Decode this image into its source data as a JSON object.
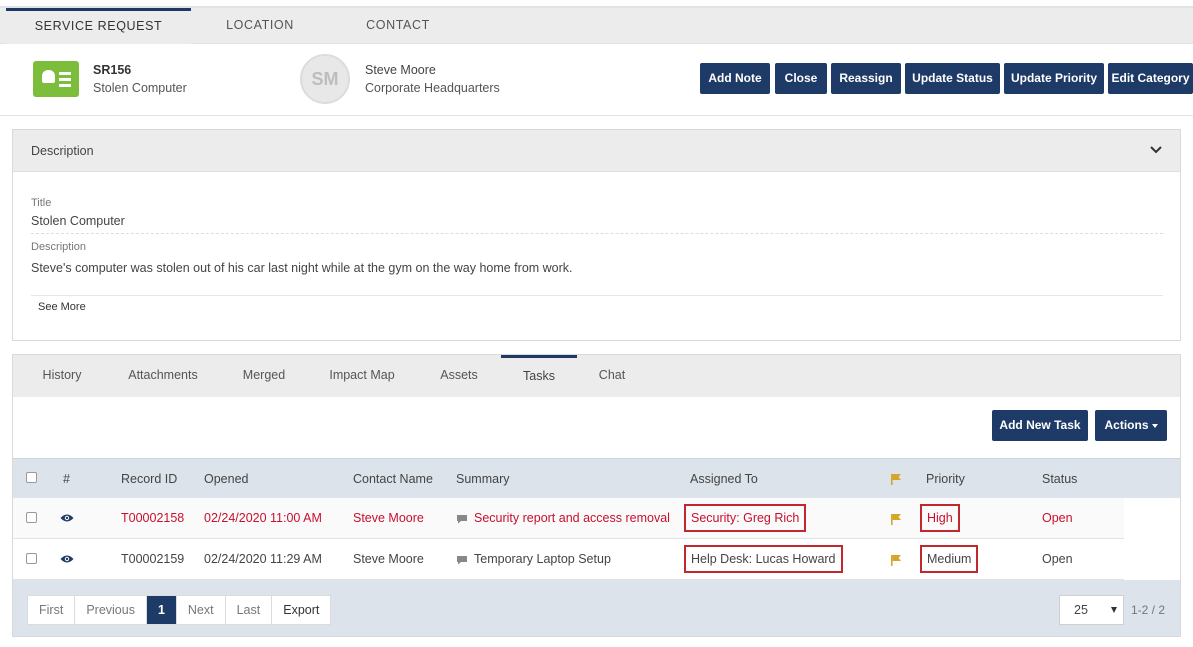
{
  "top_tabs": [
    {
      "label": "SERVICE REQUEST"
    },
    {
      "label": "LOCATION"
    },
    {
      "label": "CONTACT"
    }
  ],
  "header": {
    "id": "SR156",
    "title": "Stolen Computer",
    "avatar_initials": "SM",
    "contact_name": "Steve Moore",
    "contact_location": "Corporate Headquarters",
    "buttons": [
      "Add Note",
      "Close",
      "Reassign",
      "Update Status",
      "Update Priority",
      "Edit Category"
    ]
  },
  "description_panel": {
    "heading": "Description",
    "title_label": "Title",
    "title_value": "Stolen Computer",
    "desc_label": "Description",
    "desc_value": "Steve's computer was stolen out of his car last night while at the gym on the way home from work.",
    "see_more": "See More"
  },
  "sub_tabs": [
    "History",
    "Attachments",
    "Merged",
    "Impact Map",
    "Assets",
    "Tasks",
    "Chat"
  ],
  "task_actions": {
    "add_new_task": "Add New Task",
    "actions": "Actions"
  },
  "table": {
    "headers": [
      "#",
      "Record ID",
      "Opened",
      "Contact Name",
      "Summary",
      "Assigned To",
      "Priority",
      "Status"
    ],
    "rows": [
      {
        "record_id": "T00002158",
        "opened": "02/24/2020 11:00 AM",
        "contact": "Steve Moore",
        "summary": "Security report and access removal",
        "assigned": "Security: Greg Rich",
        "priority": "High",
        "status": "Open"
      },
      {
        "record_id": "T00002159",
        "opened": "02/24/2020 11:29 AM",
        "contact": "Steve Moore",
        "summary": "Temporary Laptop Setup",
        "assigned": "Help Desk: Lucas Howard",
        "priority": "Medium",
        "status": "Open"
      }
    ]
  },
  "pager": {
    "first": "First",
    "previous": "Previous",
    "current": "1",
    "next": "Next",
    "last": "Last",
    "export": "Export",
    "page_size": "25",
    "range": "1-2 / 2"
  },
  "colors": {
    "primary": "#1e3a66",
    "accent_green": "#7cbd3c",
    "alert_red": "#c8102e",
    "flag_gold": "#d4a72c"
  }
}
